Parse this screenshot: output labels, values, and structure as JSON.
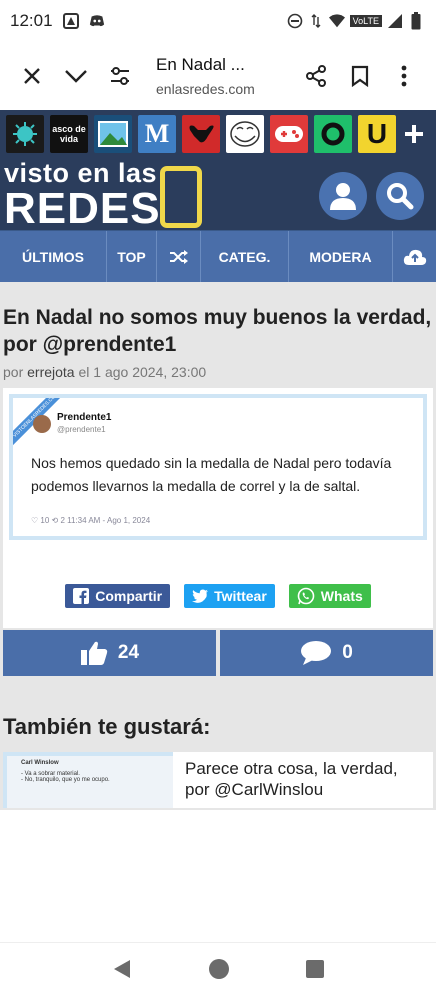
{
  "status": {
    "time": "12:01",
    "volte": "VoLTE"
  },
  "browser": {
    "title": "En Nadal ...",
    "url": "enlasredes.com"
  },
  "site": {
    "logo_top": "visto en las",
    "logo_bottom": "REDES",
    "app_icons": [
      {
        "name": "virus-icon",
        "color": "#1a1a1a",
        "label": ""
      },
      {
        "name": "asco-de-vida-icon",
        "color": "#111111",
        "label": "asco de vida"
      },
      {
        "name": "picture-icon",
        "color": "#1a4f7a",
        "label": ""
      },
      {
        "name": "m-icon",
        "color": "#3f7fc4",
        "label": "M"
      },
      {
        "name": "bull-icon",
        "color": "#d12a2a",
        "label": ""
      },
      {
        "name": "trollface-icon",
        "color": "#ffffff",
        "label": ""
      },
      {
        "name": "gamepad-icon",
        "color": "#e03a3a",
        "label": ""
      },
      {
        "name": "ring-icon",
        "color": "#1fbf6b",
        "label": ""
      },
      {
        "name": "u-icon",
        "color": "#f2d42e",
        "label": "U"
      }
    ],
    "nav": [
      "ÚLTIMOS",
      "TOP",
      "",
      "CATEG.",
      "MODERA",
      ""
    ]
  },
  "post": {
    "title": "En Nadal no somos muy buenos la verdad, por @prendente1",
    "meta_prefix": "por",
    "author": "errejota",
    "meta_suffix": "el 1 ago 2024, 23:00",
    "tweet": {
      "ribbon": "VISTOENLASREDES.COM",
      "name": "Prendente1",
      "handle": "@prendente1",
      "text": "Nos hemos quedado sin la medalla de Nadal pero todavía podemos llevarnos la medalla de correl y la de saltal.",
      "footer": "♡ 10   ⟲ 2   11:34 AM - Ago 1, 2024"
    },
    "share": {
      "facebook": "Compartir",
      "twitter": "Twittear",
      "whatsapp": "Whats"
    },
    "likes": "24",
    "comments": "0"
  },
  "related": {
    "heading": "También te gustará:",
    "items": [
      {
        "title": "Parece otra cosa, la verdad, por @CarlWinslou",
        "thumb_name": "Carl Winslow",
        "thumb_lines": [
          "- Va a sobrar material.",
          "- No, tranquilo, que yo me ocupo."
        ]
      }
    ]
  },
  "colors": {
    "header": "#2b3d5c",
    "nav": "#4a6ea9",
    "facebook": "#3b5998",
    "twitter": "#1da1f2",
    "whatsapp": "#3fbf4a"
  }
}
